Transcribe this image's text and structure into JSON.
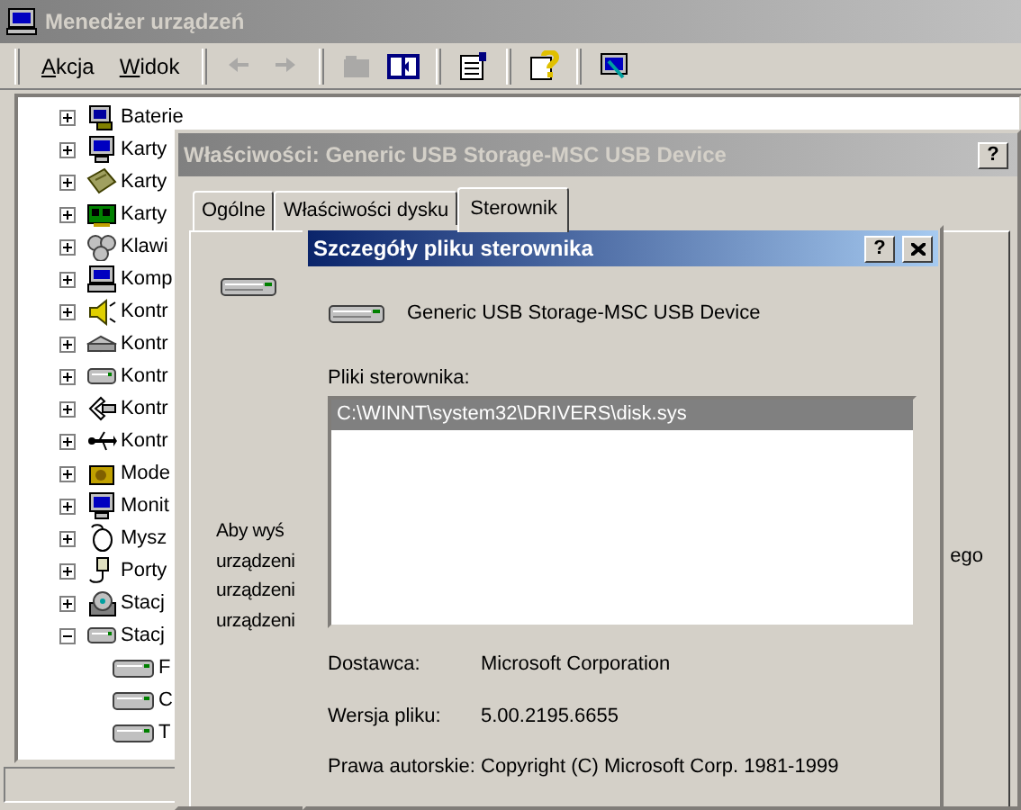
{
  "main_window": {
    "title": "Menedżer urządzeń",
    "active": false
  },
  "menu": [
    {
      "label": "Akcja"
    },
    {
      "label": "Widok"
    }
  ],
  "toolbar": [
    {
      "kind": "back",
      "disabled": true
    },
    {
      "kind": "forward",
      "disabled": true
    },
    {
      "kind": "up",
      "disabled": true
    },
    {
      "kind": "tree",
      "disabled": false
    },
    {
      "kind": "properties",
      "disabled": false
    },
    {
      "kind": "help",
      "disabled": false
    },
    {
      "kind": "scan",
      "disabled": false
    }
  ],
  "tree": [
    {
      "label": "Baterie",
      "kind": "battery",
      "expanded": false
    },
    {
      "label": "Karty",
      "kind": "monitor",
      "expanded": false
    },
    {
      "label": "Karty",
      "kind": "card",
      "expanded": false
    },
    {
      "label": "Karty",
      "kind": "chip",
      "expanded": false
    },
    {
      "label": "Klawi",
      "kind": "keyboard",
      "expanded": false
    },
    {
      "label": "Komp",
      "kind": "computer",
      "expanded": false
    },
    {
      "label": "Kontr",
      "kind": "sound",
      "expanded": false
    },
    {
      "label": "Kontr",
      "kind": "disk",
      "expanded": false
    },
    {
      "label": "Kontr",
      "kind": "drive",
      "expanded": false
    },
    {
      "label": "Kontr",
      "kind": "controller",
      "expanded": false
    },
    {
      "label": "Kontr",
      "kind": "usb",
      "expanded": false
    },
    {
      "label": "Mode",
      "kind": "modem",
      "expanded": false
    },
    {
      "label": "Monit",
      "kind": "monitor",
      "expanded": false
    },
    {
      "label": "Mysz",
      "kind": "mouse",
      "expanded": false
    },
    {
      "label": "Porty",
      "kind": "port",
      "expanded": false
    },
    {
      "label": "Stacj",
      "kind": "cdrom",
      "expanded": false
    },
    {
      "label": "Stacj",
      "kind": "drive",
      "expanded": true,
      "children": [
        {
          "label": "F"
        },
        {
          "label": "C"
        },
        {
          "label": "T"
        }
      ]
    }
  ],
  "properties": {
    "title": "Właściwości: Generic USB Storage-MSC USB Device",
    "active": false,
    "help_button": "?",
    "tabs": [
      {
        "label": "Ogólne",
        "selected": false
      },
      {
        "label": "Właściwości dysku",
        "selected": false
      },
      {
        "label": "Sterownik",
        "selected": true
      }
    ],
    "paragraph_lines": [
      "Aby wyś",
      "urządzeni",
      "urządzeni",
      "urządzeni"
    ],
    "paragraph_fragment": "ego"
  },
  "dialog": {
    "title": "Szczegóły pliku sterownika",
    "active": true,
    "help_button": "?",
    "device_name": "Generic USB Storage-MSC USB Device",
    "files_label": "Pliki sterownika:",
    "files": [
      {
        "text": "C:\\WINNT\\system32\\DRIVERS\\disk.sys",
        "selected": true
      }
    ],
    "details": [
      {
        "label": "Dostawca:",
        "value": "Microsoft Corporation"
      },
      {
        "label": "Wersja pliku:",
        "value": "5.00.2195.6655"
      },
      {
        "label": "Prawa autorskie:",
        "value": "Copyright (C) Microsoft Corp. 1981-1999"
      }
    ]
  }
}
